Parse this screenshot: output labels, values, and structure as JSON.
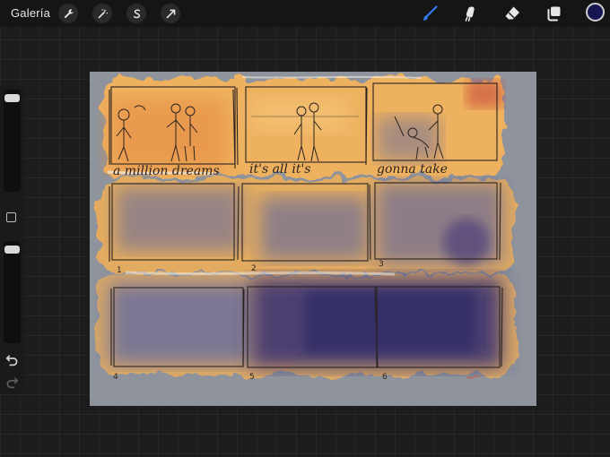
{
  "topbar": {
    "gallery_label": "Galería",
    "left_tools": [
      {
        "name": "wrench-icon"
      },
      {
        "name": "magic-wand-icon"
      },
      {
        "name": "selection-s-icon"
      },
      {
        "name": "transform-arrow-icon"
      }
    ],
    "right_tools": [
      {
        "name": "brush-icon",
        "active": true
      },
      {
        "name": "smudge-icon",
        "active": false
      },
      {
        "name": "eraser-icon",
        "active": false
      },
      {
        "name": "layers-icon",
        "active": false
      }
    ],
    "current_color": "#161652",
    "active_tool_color": "#2f7cf6"
  },
  "sidebar": {
    "brush_size_level": 0.05,
    "opacity_level": 0.05,
    "undo_icon": "undo-icon",
    "redo_icon": "redo-icon"
  },
  "canvas": {
    "paper_color": "#8e939c",
    "captions": [
      "a million dreams",
      "it's all it's",
      "gonna take"
    ],
    "panel_numbers": [
      "1",
      "2",
      "3",
      "4",
      "5",
      "6"
    ]
  }
}
